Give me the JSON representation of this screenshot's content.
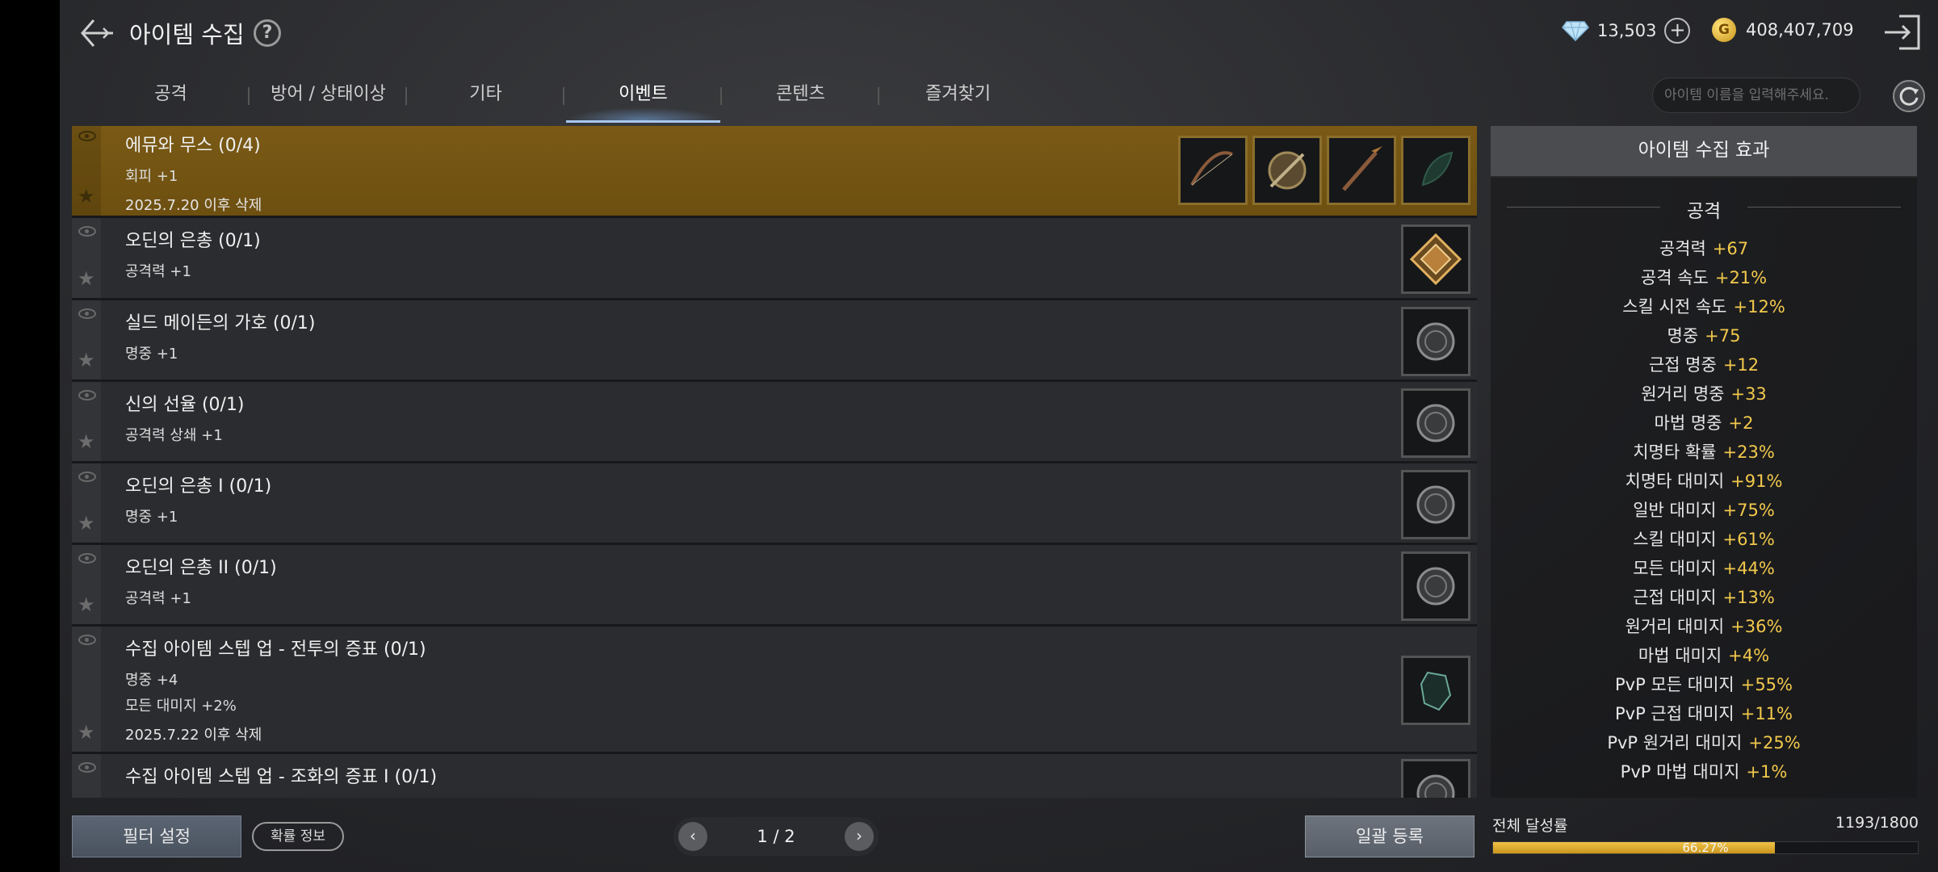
{
  "header": {
    "title": "아이템 수집",
    "help_icon": "?",
    "diamond": "13,503",
    "plus": "+",
    "gold_icon": "G",
    "gold": "408,407,709"
  },
  "tabs": [
    "공격",
    "방어 / 상태이상",
    "기타",
    "이벤트",
    "콘텐츠",
    "즐겨찾기"
  ],
  "active_tab": "이벤트",
  "search": {
    "placeholder": "아이템 이름을 입력해주세요."
  },
  "list": [
    {
      "name": "에뮤와 무스 (0/4)",
      "effects": [
        "회피 +1"
      ],
      "date": "2025.7.20 이후 삭제",
      "slots": 4,
      "highlight": true
    },
    {
      "name": "오딘의 은총 (0/1)",
      "effects": [
        "공격력 +1"
      ],
      "date": "",
      "slots": 1
    },
    {
      "name": "실드 메이든의 가호 (0/1)",
      "effects": [
        "명중 +1"
      ],
      "date": "",
      "slots": 1
    },
    {
      "name": "신의 선율 (0/1)",
      "effects": [
        "공격력 상쇄 +1"
      ],
      "date": "",
      "slots": 1
    },
    {
      "name": "오딘의 은총 I  (0/1)",
      "effects": [
        "명중 +1"
      ],
      "date": "",
      "slots": 1
    },
    {
      "name": "오딘의 은총 II  (0/1)",
      "effects": [
        "공격력 +1"
      ],
      "date": "",
      "slots": 1
    },
    {
      "name": "수집 아이템 스텝 업 - 전투의 증표 (0/1)",
      "effects": [
        "명중 +4",
        "모든 대미지 +2%"
      ],
      "date": "2025.7.22 이후 삭제",
      "slots": 1
    },
    {
      "name": "수집 아이템 스텝 업 - 조화의 증표 I  (0/1)",
      "effects": [],
      "date": "",
      "slots": 1
    }
  ],
  "panel": {
    "title": "아이템 수집 효과",
    "category": "공격",
    "effects": [
      {
        "label": "공격력",
        "value": "+67"
      },
      {
        "label": "공격 속도",
        "value": "+21%"
      },
      {
        "label": "스킬 시전 속도",
        "value": "+12%"
      },
      {
        "label": "명중",
        "value": "+75"
      },
      {
        "label": "근접 명중",
        "value": "+12"
      },
      {
        "label": "원거리 명중",
        "value": "+33"
      },
      {
        "label": "마법 명중",
        "value": "+2"
      },
      {
        "label": "치명타 확률",
        "value": "+23%"
      },
      {
        "label": "치명타 대미지",
        "value": "+91%"
      },
      {
        "label": "일반 대미지",
        "value": "+75%"
      },
      {
        "label": "스킬 대미지",
        "value": "+61%"
      },
      {
        "label": "모든 대미지",
        "value": "+44%"
      },
      {
        "label": "근접 대미지",
        "value": "+13%"
      },
      {
        "label": "원거리 대미지",
        "value": "+36%"
      },
      {
        "label": "마법 대미지",
        "value": "+4%"
      },
      {
        "label": "PvP 모든 대미지",
        "value": "+55%"
      },
      {
        "label": "PvP 근접 대미지",
        "value": "+11%"
      },
      {
        "label": "PvP 원거리 대미지",
        "value": "+25%"
      },
      {
        "label": "PvP 마법 대미지",
        "value": "+1%"
      }
    ]
  },
  "footer": {
    "filter_label": "필터 설정",
    "prob_label": "확률 정보",
    "page": "1 / 2",
    "prev": "‹",
    "next": "›",
    "bulk_label": "일괄 등록",
    "progress_label": "전체 달성률",
    "progress_count": "1193/1800",
    "progress_text": "66.27%",
    "progress_fraction": 0.6627
  },
  "colors": {
    "accent_gold": "#f2c94c",
    "highlight_row": "#7a5a15"
  }
}
